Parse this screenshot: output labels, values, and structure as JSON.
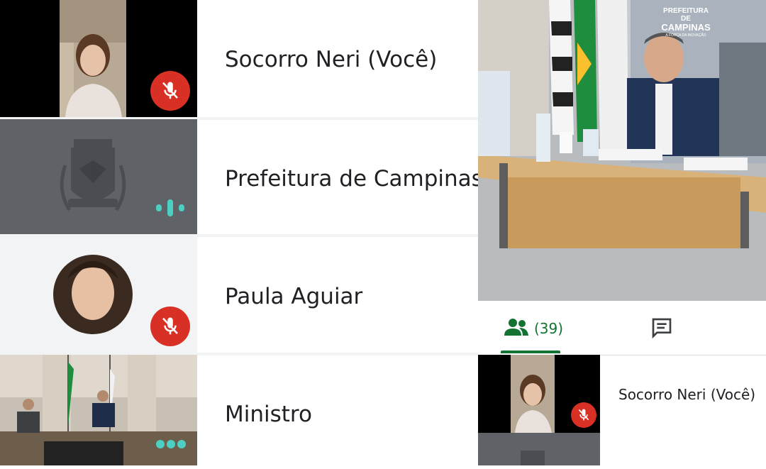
{
  "participants": [
    {
      "name": "Socorro Neri (Você)",
      "muted": true
    },
    {
      "name": "Prefeitura de Campinas",
      "speaking": true
    },
    {
      "name": "Paula Aguiar",
      "muted": true
    },
    {
      "name": "Ministro",
      "more": true
    }
  ],
  "tabs": {
    "people_count": "(39)"
  },
  "photo_sign": {
    "line1": "PREFEITURA DE",
    "line2": "CAMPINAS",
    "tagline": "A FORÇA DA INOVAÇÃO"
  },
  "right_list": {
    "first_name": "Socorro Neri (Você)"
  },
  "colors": {
    "mute_red": "#d93025",
    "speaking_teal": "#4dd0c4",
    "tab_green": "#137333"
  }
}
